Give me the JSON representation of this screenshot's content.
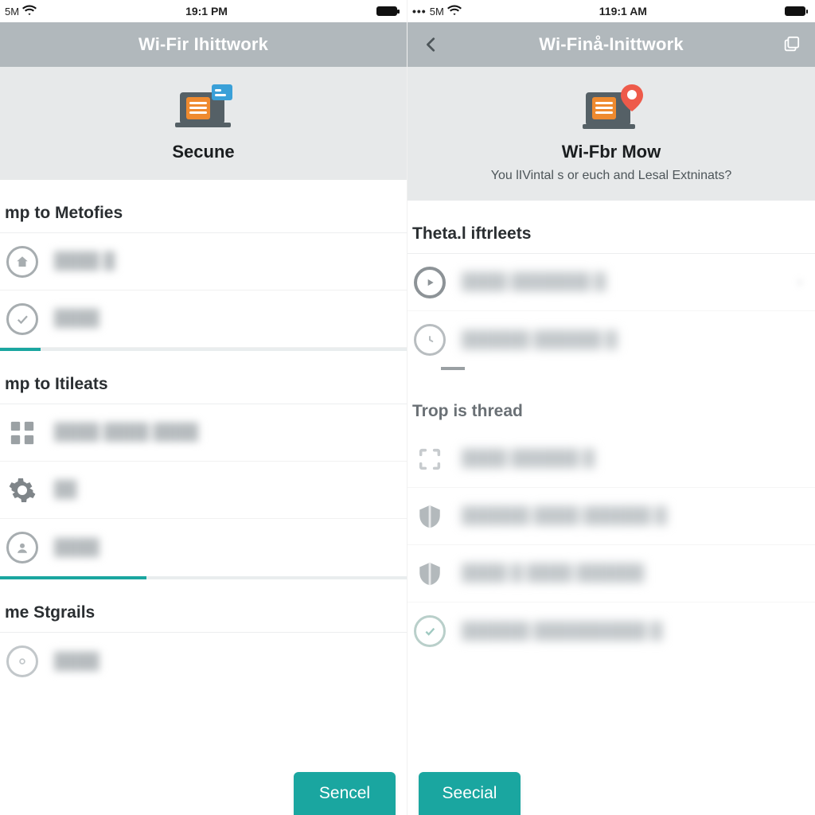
{
  "left": {
    "status": {
      "carrier": "5M",
      "time": "19:1 PM",
      "battery_pct": 100
    },
    "nav": {
      "title": "Wi-Fir Ihittwork"
    },
    "hero": {
      "title": "Secune"
    },
    "section1_title": "mp to Metofies",
    "section1_rows": [
      {
        "icon": "home-circle",
        "label": ""
      },
      {
        "icon": "check-circle",
        "label": ""
      }
    ],
    "progress1_pct": 10,
    "section2_title": "mp to Itileats",
    "section2_rows": [
      {
        "icon": "grid",
        "label": ""
      },
      {
        "icon": "gear",
        "label": ""
      },
      {
        "icon": "user-circle",
        "label": ""
      }
    ],
    "progress2_pct": 36,
    "section3_title": "me Stgrails",
    "section3_rows": [
      {
        "icon": "target",
        "label": ""
      }
    ],
    "button_label": "Sencel"
  },
  "right": {
    "status": {
      "carrier": "5M",
      "time": "119:1 AM",
      "battery_pct": 100
    },
    "nav": {
      "title": "Wi-Finå-Inittwork"
    },
    "hero": {
      "title": "Wi-Fbr Mow",
      "subtitle": "You lIVintal s or euch and Lesal Extninats?"
    },
    "section1_title": "Theta.l iftrleets",
    "section1_rows": [
      {
        "icon": "play-circle",
        "label": "",
        "chevron": true
      },
      {
        "icon": "clock-circle",
        "label": ""
      }
    ],
    "section2_title": "Trop is thread",
    "section2_rows": [
      {
        "icon": "scan",
        "label": ""
      },
      {
        "icon": "shield",
        "label": ""
      },
      {
        "icon": "shield",
        "label": ""
      },
      {
        "icon": "check-badge",
        "label": ""
      }
    ],
    "button_label": "Seecial"
  },
  "colors": {
    "accent": "#1aa6a0",
    "navbar": "#b1b8bc",
    "hero_bg": "#e7e9ea"
  }
}
